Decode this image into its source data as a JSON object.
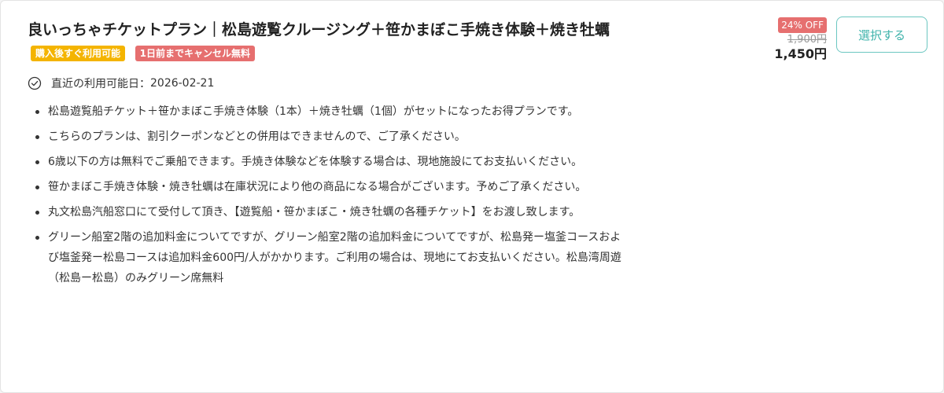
{
  "plan": {
    "title": "良いっちゃチケットプラン｜松島遊覧クルージング＋笹かまぼこ手焼き体験＋焼き牡蠣",
    "badges": {
      "instant": "購入後すぐ利用可能",
      "cancel": "1日前までキャンセル無料"
    },
    "availability_label": "直近の利用可能日：",
    "availability_date": "2026-02-21",
    "notes": [
      "松島遊覧船チケット＋笹かまぼこ手焼き体験（1本）＋焼き牡蠣（1個）がセットになったお得プランです。",
      "こちらのプランは、割引クーポンなどとの併用はできませんので、ご了承ください。",
      "6歳以下の方は無料でご乗船できます。手焼き体験などを体験する場合は、現地施設にてお支払いください。",
      "笹かまぼこ手焼き体験・焼き牡蠣は在庫状況により他の商品になる場合がございます。予めご了承ください。",
      "丸文松島汽船窓口にて受付して頂き、【遊覧船・笹かまぼこ・焼き牡蠣の各種チケット】をお渡し致します。",
      "グリーン船室2階の追加料金についてですが、グリーン船室2階の追加料金についてですが、松島発ー塩釜コースおよび塩釜発ー松島コースは追加料金600円/人がかかります。ご利用の場合は、現地にてお支払いください。松島湾周遊（松島ー松島）のみグリーン席無料"
    ]
  },
  "price": {
    "discount": "24% OFF",
    "original": "1,900円",
    "current": "1,450円"
  },
  "actions": {
    "select_label": "選択する"
  },
  "icons": {
    "availability": "check-circle-icon"
  },
  "colors": {
    "accent": "#3fb3ab",
    "badge_yellow": "#f4b400",
    "badge_red": "#e66f6f"
  }
}
